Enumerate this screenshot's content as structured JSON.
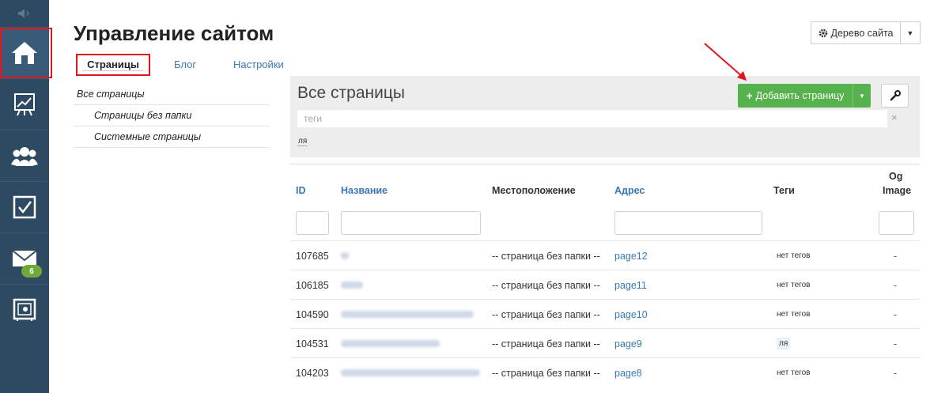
{
  "sidebar": {
    "items": [
      {
        "icon": "home-icon",
        "active": true
      },
      {
        "icon": "chart-board-icon",
        "active": false
      },
      {
        "icon": "users-icon",
        "active": false
      },
      {
        "icon": "checkbox-icon",
        "active": false
      },
      {
        "icon": "mail-icon",
        "active": false,
        "badge": "6"
      },
      {
        "icon": "safe-icon",
        "active": false
      }
    ]
  },
  "header": {
    "title": "Управление сайтом",
    "tree_button": "Дерево сайта"
  },
  "tabs": [
    {
      "label": "Страницы",
      "active": true
    },
    {
      "label": "Блог",
      "active": false
    },
    {
      "label": "Настройки",
      "active": false
    }
  ],
  "folders": [
    {
      "label": "Все страницы",
      "level": 0
    },
    {
      "label": "Страницы без папки",
      "level": 1
    },
    {
      "label": "Системные страницы",
      "level": 1
    }
  ],
  "panel": {
    "title": "Все страницы",
    "add_button": "Добавить страницу",
    "tags_placeholder": "теги",
    "tags_clear": "×",
    "tag_chip": "ля"
  },
  "table": {
    "headers": {
      "id": "ID",
      "name": "Название",
      "location": "Местоположение",
      "address": "Адрес",
      "tags": "Теги",
      "og_image_1": "Og",
      "og_image_2": "Image"
    },
    "rows": [
      {
        "id": "107685",
        "location": "-- страница без папки --",
        "address": "page12",
        "tags": "нет тегов",
        "og": "-"
      },
      {
        "id": "106185",
        "location": "-- страница без папки --",
        "address": "page11",
        "tags": "нет тегов",
        "og": "-"
      },
      {
        "id": "104590",
        "location": "-- страница без папки --",
        "address": "page10",
        "tags": "нет тегов",
        "og": "-"
      },
      {
        "id": "104531",
        "location": "-- страница без папки --",
        "address": "page9",
        "tags": "ля",
        "og": "-"
      },
      {
        "id": "104203",
        "location": "-- страница без папки --",
        "address": "page8",
        "tags": "нет тегов",
        "og": "-"
      }
    ]
  },
  "colors": {
    "sidebar": "#2e4a62",
    "accent_link": "#3a78b5",
    "add_button": "#56b24c",
    "highlight_red": "#e0161e",
    "badge_green": "#6fa93a"
  }
}
